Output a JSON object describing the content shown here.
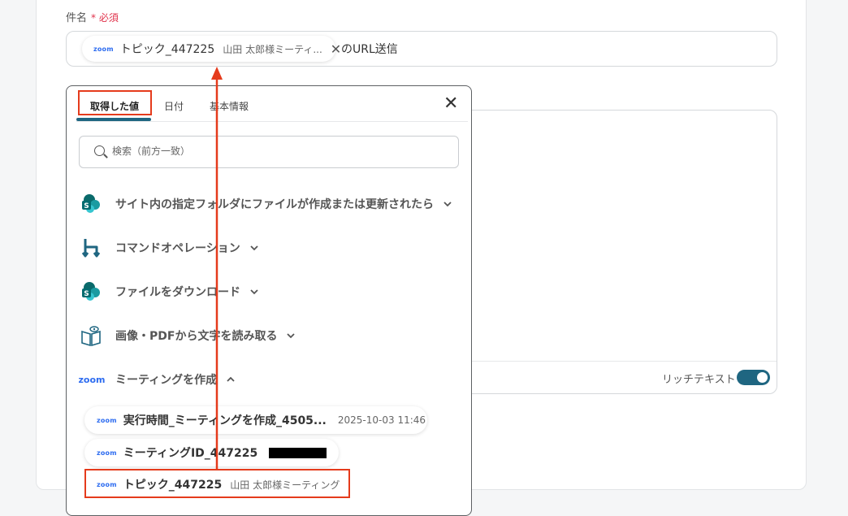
{
  "form": {
    "subject_label": "件名",
    "required_label": "* 必須",
    "subject_token": {
      "logo": "zoom",
      "title": "トピック_447225",
      "subtitle": "山田 太郎様ミーティ..."
    },
    "subject_suffix": "のURL送信",
    "rich_text_label": "リッチテキスト",
    "rich_text_enabled": true
  },
  "popup": {
    "tabs": [
      {
        "label": "取得した値",
        "active": true
      },
      {
        "label": "日付",
        "active": false
      },
      {
        "label": "基本情報",
        "active": false
      }
    ],
    "search_placeholder": "検索（前方一致）",
    "groups": [
      {
        "label": "サイト内の指定フォルダにファイルが作成または更新されたら",
        "icon": "sharepoint-icon",
        "expanded": false
      },
      {
        "label": "コマンドオペレーション",
        "icon": "command-operation-icon",
        "expanded": false
      },
      {
        "label": "ファイルをダウンロード",
        "icon": "sharepoint-icon",
        "expanded": false
      },
      {
        "label": "画像・PDFから文字を読み取る",
        "icon": "ocr-book-icon",
        "expanded": false
      },
      {
        "label": "ミーティングを作成",
        "icon": "zoom-logo",
        "expanded": true
      }
    ],
    "zoom_logo_text": "zoom",
    "values": [
      {
        "title": "実行時間_ミーティングを作成_4505...",
        "value": "2025-10-03 11:46"
      },
      {
        "title": "ミーティングID_447225",
        "value": "(redacted)"
      },
      {
        "title": "トピック_447225",
        "value": "山田 太郎様ミーティング"
      }
    ]
  },
  "colors": {
    "accent": "#1f6681",
    "highlight": "#e53b1c",
    "sharepoint": "#0f7b7c",
    "zoom": "#2d6cf0",
    "required": "#e0324b"
  }
}
